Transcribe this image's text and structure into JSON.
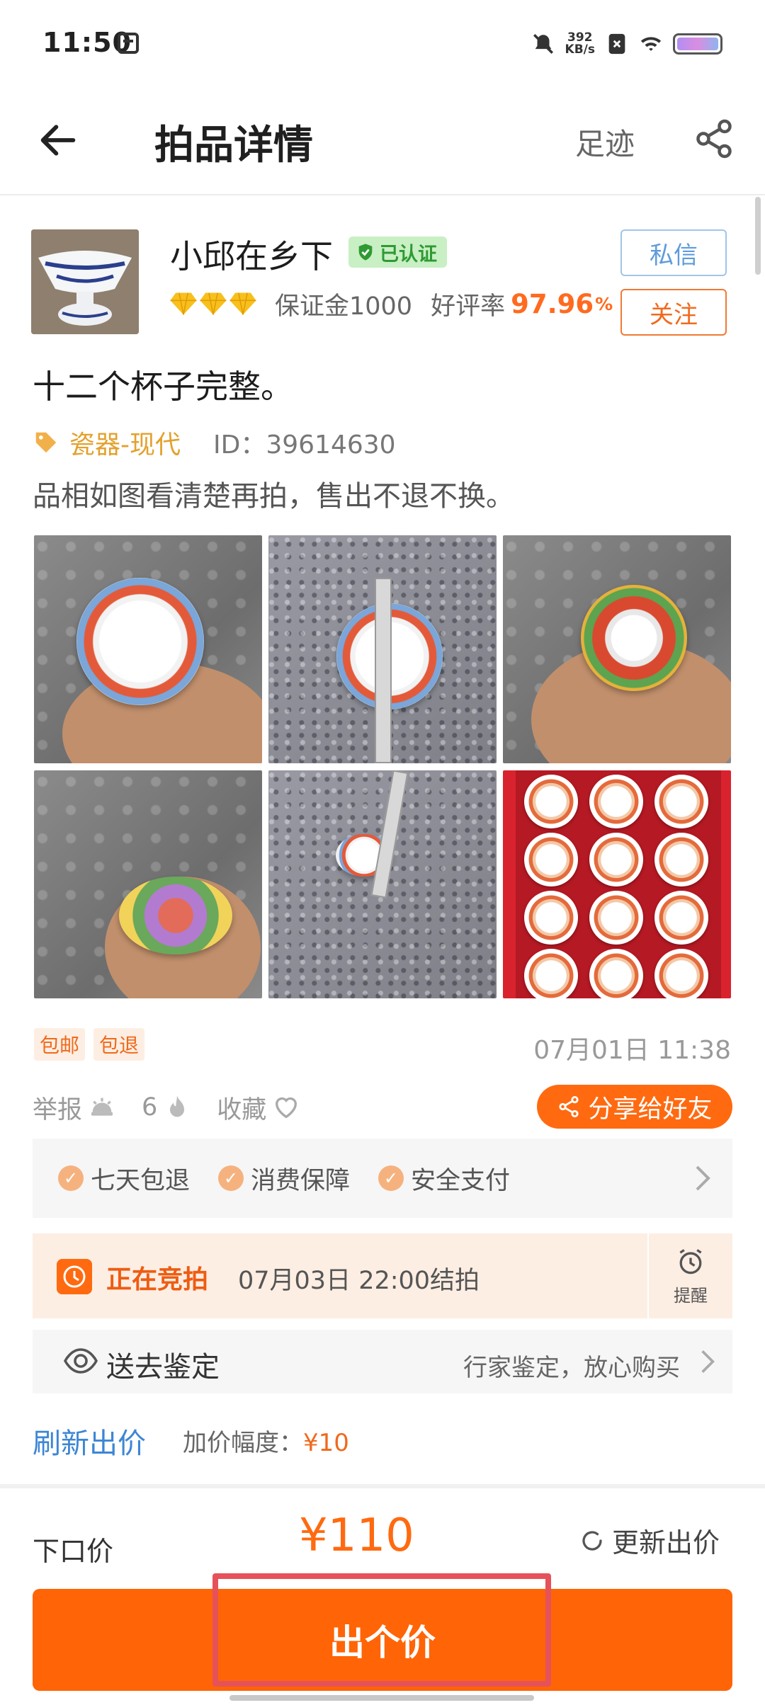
{
  "status_bar": {
    "time": "11:50",
    "net_speed_value": "392",
    "net_speed_unit": "KB/s"
  },
  "header": {
    "title": "拍品详情",
    "footprint": "足迹"
  },
  "seller": {
    "name": "小邱在乡下",
    "verified": "已认证",
    "deposit": "保证金1000",
    "rating_label": "好评率",
    "rating_value": "97.96",
    "rating_unit": "%",
    "message_btn": "私信",
    "follow_btn": "关注",
    "diamond_count": 3
  },
  "item": {
    "title": "十二个杯子完整。",
    "category": "瓷器-现代",
    "id": "ID：39614630",
    "description": "品相如图看清楚再拍，售出不退不换。",
    "badges": [
      "包邮",
      "包退"
    ],
    "post_time": "07月01日 11:38"
  },
  "actions": {
    "report": "举报",
    "likes": "6",
    "collect": "收藏",
    "share": "分享给好友"
  },
  "guarantees": [
    "七天包退",
    "消费保障",
    "安全支付"
  ],
  "auction": {
    "status": "正在竞拍",
    "end_time": "07月03日 22:00结拍",
    "remind": "提醒"
  },
  "appraisal": {
    "title": "送去鉴定",
    "note": "行家鉴定，放心购买"
  },
  "bid": {
    "refresh": "刷新出价",
    "increment_label": "加价幅度：",
    "increment_value": "¥10",
    "next_price_label": "下口价",
    "next_price": "¥110",
    "update": "更新出价",
    "button": "出个价"
  },
  "colors": {
    "accent": "#ff6406",
    "link": "#3d86d4",
    "verified": "#2e9a33",
    "highlight": "#e6525a"
  }
}
